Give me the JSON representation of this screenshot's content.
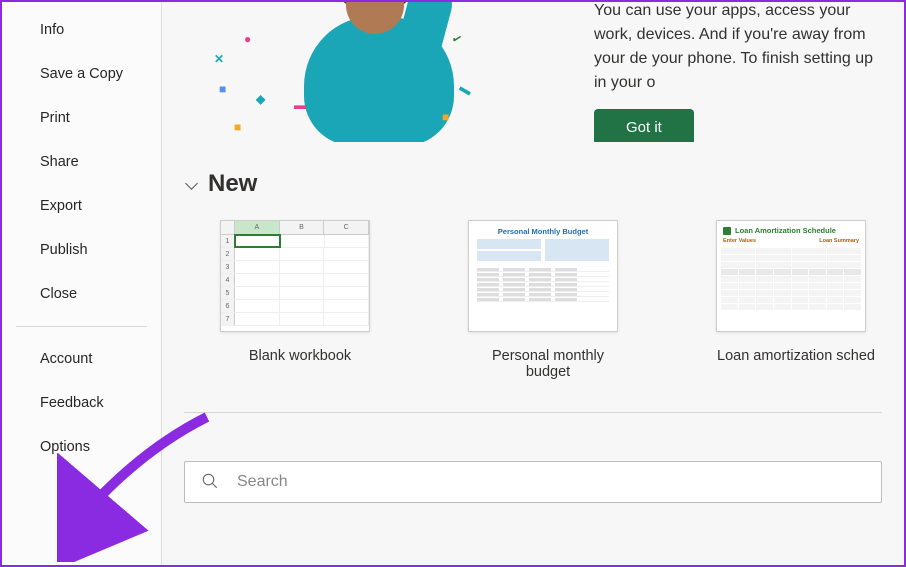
{
  "sidebar": {
    "top": [
      {
        "label": "Info",
        "name": "sidebar-item-info"
      },
      {
        "label": "Save a Copy",
        "name": "sidebar-item-save-copy"
      },
      {
        "label": "Print",
        "name": "sidebar-item-print"
      },
      {
        "label": "Share",
        "name": "sidebar-item-share"
      },
      {
        "label": "Export",
        "name": "sidebar-item-export"
      },
      {
        "label": "Publish",
        "name": "sidebar-item-publish"
      },
      {
        "label": "Close",
        "name": "sidebar-item-close"
      }
    ],
    "bottom": [
      {
        "label": "Account",
        "name": "sidebar-item-account"
      },
      {
        "label": "Feedback",
        "name": "sidebar-item-feedback"
      },
      {
        "label": "Options",
        "name": "sidebar-item-options"
      }
    ]
  },
  "banner": {
    "text": "You can use your apps, access your work, devices. And if you're away from your de your phone. To finish setting up in your o",
    "got_it_label": "Got it"
  },
  "section": {
    "new_label": "New"
  },
  "templates": [
    {
      "label": "Blank workbook",
      "name": "template-blank-workbook"
    },
    {
      "label": "Personal monthly budget",
      "name": "template-personal-monthly-budget",
      "thumb_title": "Personal Monthly Budget"
    },
    {
      "label": "Loan amortization sched",
      "name": "template-loan-amortization",
      "thumb_title": "Loan Amortization Schedule",
      "thumb_sec_left": "Enter Values",
      "thumb_sec_right": "Loan Summary"
    }
  ],
  "search": {
    "placeholder": "Search"
  },
  "colors": {
    "accent": "#217346",
    "annotation": "#8a2be2"
  }
}
